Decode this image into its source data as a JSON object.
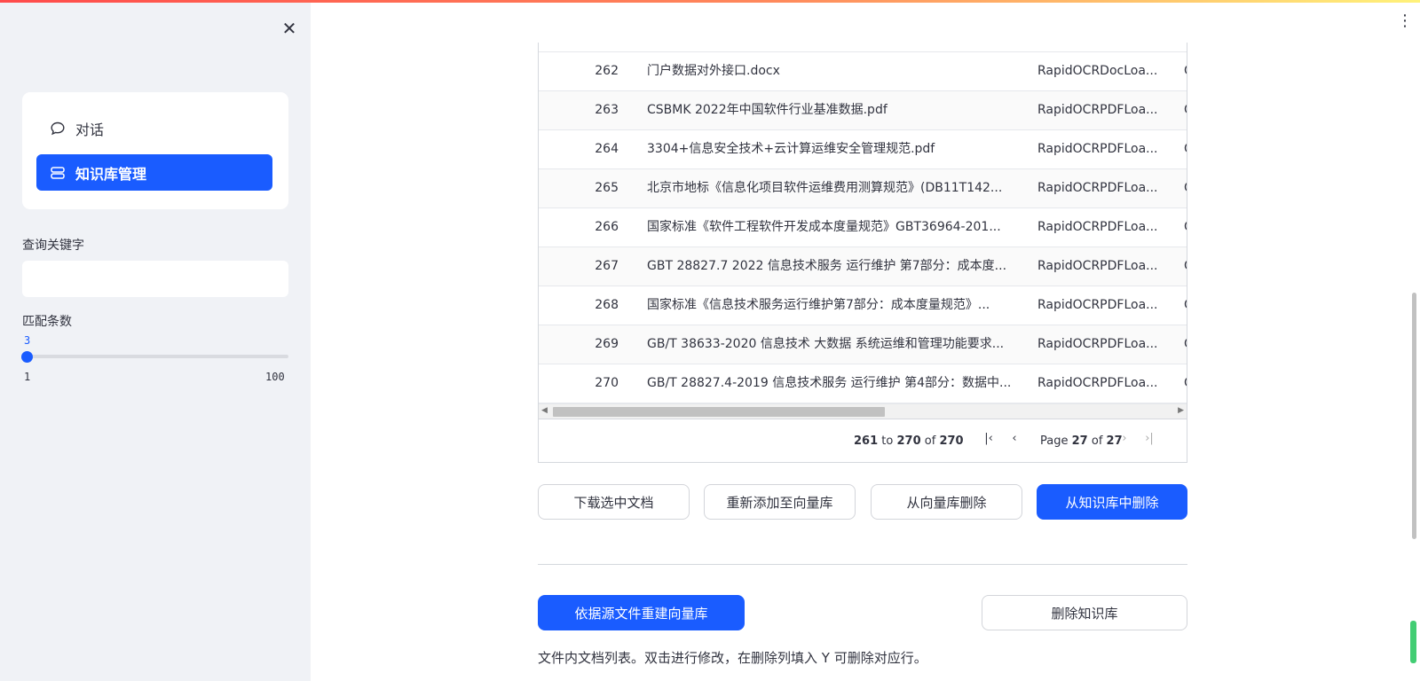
{
  "sidebar": {
    "close_icon": "close-icon",
    "menu": [
      {
        "label": "对话",
        "icon": "chat-bubble-icon",
        "active": false
      },
      {
        "label": "知识库管理",
        "icon": "database-icon",
        "active": true
      }
    ],
    "search_label": "查询关键字",
    "search_value": "",
    "count_label": "匹配条数",
    "slider": {
      "value": "3",
      "min": "1",
      "max": "100"
    }
  },
  "grid": {
    "rows": [
      {
        "no": "262",
        "name": "门户数据对外接口.docx",
        "loader": "RapidOCRDocLoa...",
        "extra": "C"
      },
      {
        "no": "263",
        "name": "CSBMK 2022年中国软件行业基准数据.pdf",
        "loader": "RapidOCRPDFLoa...",
        "extra": "C"
      },
      {
        "no": "264",
        "name": "3304+信息安全技术+云计算运维安全管理规范.pdf",
        "loader": "RapidOCRPDFLoa...",
        "extra": "C"
      },
      {
        "no": "265",
        "name": "北京市地标《信息化项目软件运维费用测算规范》(DB11T142...",
        "loader": "RapidOCRPDFLoa...",
        "extra": "C"
      },
      {
        "no": "266",
        "name": "国家标准《软件工程软件开发成本度量规范》GBT36964-201...",
        "loader": "RapidOCRPDFLoa...",
        "extra": "C"
      },
      {
        "no": "267",
        "name": "GBT 28827.7 2022 信息技术服务 运行维护 第7部分：成本度...",
        "loader": "RapidOCRPDFLoa...",
        "extra": "C"
      },
      {
        "no": "268",
        "name": "国家标准《信息技术服务运行维护第7部分：成本度量规范》...",
        "loader": "RapidOCRPDFLoa...",
        "extra": "C"
      },
      {
        "no": "269",
        "name": "GB/T 38633-2020 信息技术 大数据 系统运维和管理功能要求...",
        "loader": "RapidOCRPDFLoa...",
        "extra": "C"
      },
      {
        "no": "270",
        "name": "GB/T 28827.4-2019 信息技术服务 运行维护 第4部分：数据中...",
        "loader": "RapidOCRPDFLoa...",
        "extra": "C"
      }
    ],
    "pagination": {
      "from": "261",
      "to_word": "to",
      "to": "270",
      "of_word": "of",
      "total": "270",
      "page_word": "Page",
      "page": "27",
      "page_of": "of",
      "pages": "27"
    }
  },
  "actions": {
    "download": "下载选中文档",
    "re_add": "重新添加至向量库",
    "remove_vector": "从向量库删除",
    "remove_kb": "从知识库中删除",
    "rebuild": "依据源文件重建向量库",
    "delete_kb": "删除知识库"
  },
  "caption": "文件内文档列表。双击进行修改，在删除列填入 Y 可删除对应行。",
  "colors": {
    "accent": "#1a5cff",
    "sidebar_bg": "#f0f2f6"
  }
}
